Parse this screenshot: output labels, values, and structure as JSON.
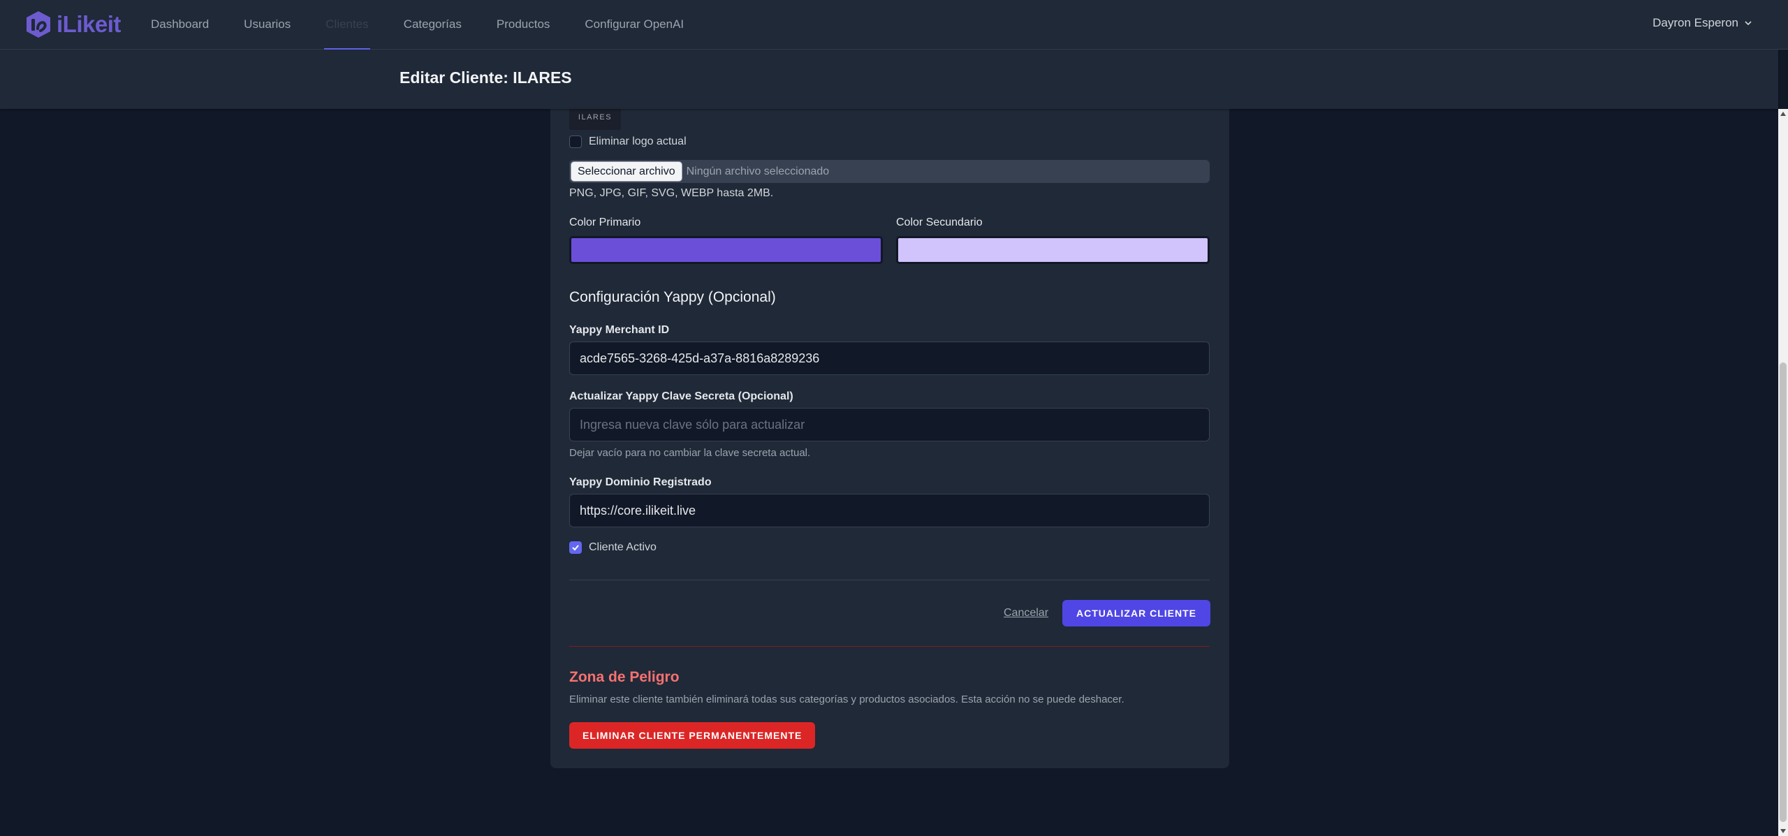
{
  "app": {
    "brand": "iLikeit",
    "colors": {
      "brand": "#6d5bd0",
      "accent": "#4f46e5",
      "danger": "#dc2626",
      "danger_text": "#f87171"
    }
  },
  "nav": {
    "items": [
      {
        "label": "Dashboard"
      },
      {
        "label": "Usuarios"
      },
      {
        "label": "Clientes",
        "active": true
      },
      {
        "label": "Categorías"
      },
      {
        "label": "Productos"
      },
      {
        "label": "Configurar OpenAI"
      }
    ],
    "user_name": "Dayron Esperon",
    "user_icon": "chevron-down-icon"
  },
  "header": {
    "title": "Editar Cliente: ILARES"
  },
  "form": {
    "logo_preview_text": "ILARES",
    "remove_logo_label": "Eliminar logo actual",
    "remove_logo_checked": false,
    "file_button_label": "Seleccionar archivo",
    "file_status": "Ningún archivo seleccionado",
    "file_hint": "PNG, JPG, GIF, SVG, WEBP hasta 2MB.",
    "primary_color_label": "Color Primario",
    "primary_color_value": "#6b4fd8",
    "secondary_color_label": "Color Secundario",
    "secondary_color_value": "#d1c4fc",
    "yappy_section_title": "Configuración Yappy (Opcional)",
    "merchant_id_label": "Yappy Merchant ID",
    "merchant_id_value": "acde7565-3268-425d-a37a-8816a8289236",
    "secret_label": "Actualizar Yappy Clave Secreta (Opcional)",
    "secret_placeholder": "Ingresa nueva clave sólo para actualizar",
    "secret_hint": "Dejar vacío para no cambiar la clave secreta actual.",
    "domain_label": "Yappy Dominio Registrado",
    "domain_value": "https://core.ilikeit.live",
    "active_label": "Cliente Activo",
    "active_checked": true,
    "cancel_label": "Cancelar",
    "submit_label": "ACTUALIZAR CLIENTE"
  },
  "danger": {
    "title": "Zona de Peligro",
    "description": "Eliminar este cliente también eliminará todas sus categorías y productos asociados. Esta acción no se puede deshacer.",
    "button_label": "ELIMINAR CLIENTE PERMANENTEMENTE"
  }
}
